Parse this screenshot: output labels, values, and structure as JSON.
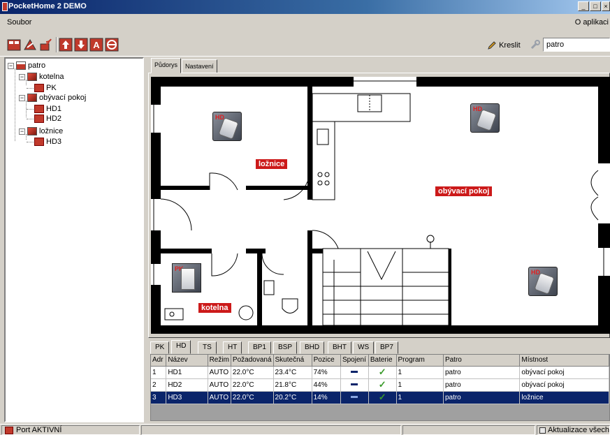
{
  "window": {
    "title": "PocketHome 2 DEMO"
  },
  "menu": {
    "left": "Soubor",
    "right": "O aplikaci"
  },
  "toolbar": {
    "draw_label": "Kreslit",
    "floor_value": "patro"
  },
  "tree": {
    "root": "patro",
    "rooms": [
      {
        "label": "kotelna",
        "devices": [
          "PK"
        ]
      },
      {
        "label": "obývací pokoj",
        "devices": [
          "HD1",
          "HD2"
        ]
      },
      {
        "label": "ložnice",
        "devices": [
          "HD3"
        ]
      }
    ]
  },
  "plan_tabs": [
    "Půdorys",
    "Nastavení"
  ],
  "plan": {
    "room_labels": {
      "loznice": "ložnice",
      "obyvaci": "obývací pokoj",
      "kotelna": "kotelna"
    },
    "device_badge_hd": "HD",
    "device_badge_pk": "PK"
  },
  "device_tabs": [
    "PK",
    "HD",
    "TS",
    "HT",
    "BP1",
    "BSP",
    "BHD",
    "BHT",
    "WS",
    "BP7"
  ],
  "table": {
    "columns": [
      "Adr",
      "Název",
      "Režim",
      "Požadovaná",
      "Skutečná",
      "Pozice",
      "Spojení",
      "Baterie",
      "Program",
      "Patro",
      "Místnost"
    ],
    "rows": [
      {
        "adr": "1",
        "name": "HD1",
        "mode": "AUTO",
        "req": "22.0°C",
        "act": "23.4°C",
        "pos": "74%",
        "prog": "1",
        "floor": "patro",
        "room": "obývací pokoj"
      },
      {
        "adr": "2",
        "name": "HD2",
        "mode": "AUTO",
        "req": "22.0°C",
        "act": "21.8°C",
        "pos": "44%",
        "prog": "1",
        "floor": "patro",
        "room": "obývací pokoj"
      },
      {
        "adr": "3",
        "name": "HD3",
        "mode": "AUTO",
        "req": "22.0°C",
        "act": "20.2°C",
        "pos": "14%",
        "prog": "1",
        "floor": "patro",
        "room": "ložnice"
      }
    ]
  },
  "status": {
    "port": "Port AKTIVNÍ",
    "update": "Aktualizace všech"
  },
  "colors": {
    "title_bar": "#0a246a",
    "room_label": "#cc1a1a",
    "selection": "#0a246a",
    "wall": "#000000"
  }
}
